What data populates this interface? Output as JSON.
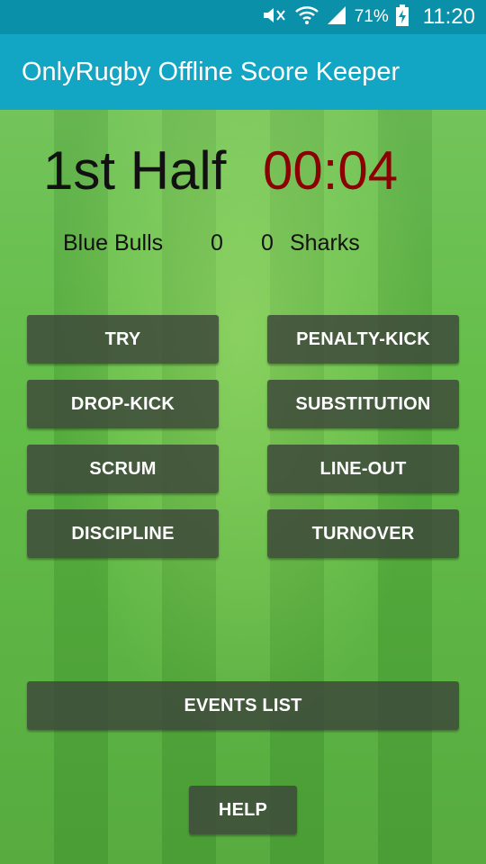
{
  "status_bar": {
    "battery_pct": "71%",
    "time": "11:20",
    "icons": [
      "mute-icon",
      "wifi-icon",
      "signal-icon",
      "battery-charging-icon"
    ]
  },
  "app_bar": {
    "title": "OnlyRugby Offline Score Keeper"
  },
  "match": {
    "period": "1st Half",
    "clock": "00:04",
    "clock_color": "#8b0000",
    "home_team": "Blue Bulls",
    "home_score": "0",
    "away_score": "0",
    "away_team": "Sharks"
  },
  "actions": {
    "try": "TRY",
    "penalty_kick": "PENALTY-KICK",
    "drop_kick": "DROP-KICK",
    "substitution": "SUBSTITUTION",
    "scrum": "SCRUM",
    "line_out": "LINE-OUT",
    "discipline": "DISCIPLINE",
    "turnover": "TURNOVER",
    "events_list": "EVENTS LIST",
    "help": "HELP"
  },
  "colors": {
    "status_bar": "#0a91a9",
    "app_bar": "#12a6c4",
    "button": "#3e483a",
    "grass": "#5fb843"
  }
}
